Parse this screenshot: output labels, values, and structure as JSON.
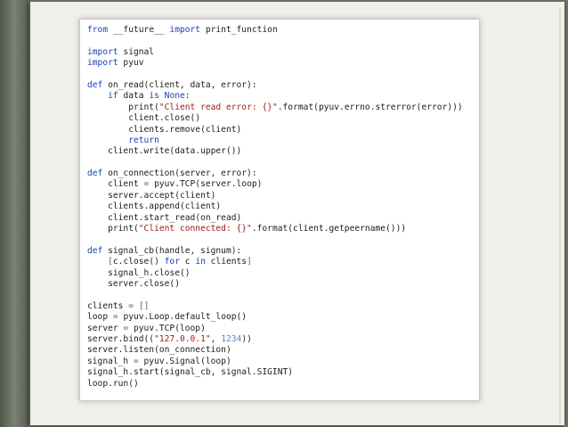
{
  "colors": {
    "background": "#6f7568",
    "page": "#f1efe9",
    "code_background": "#ffffff",
    "keyword": "#1a3fb6",
    "string": "#9a1b1b",
    "number": "#4f87c2",
    "text": "#1c1c1c"
  },
  "code": {
    "language": "python",
    "lines": [
      "from __future__ import print_function",
      "",
      "import signal",
      "import pyuv",
      "",
      "def on_read(client, data, error):",
      "    if data is None:",
      "        print(\"Client read error: {}\".format(pyuv.errno.strerror(error)))",
      "        client.close()",
      "        clients.remove(client)",
      "        return",
      "    client.write(data.upper())",
      "",
      "def on_connection(server, error):",
      "    client = pyuv.TCP(server.loop)",
      "    server.accept(client)",
      "    clients.append(client)",
      "    client.start_read(on_read)",
      "    print(\"Client connected: {}\".format(client.getpeername()))",
      "",
      "def signal_cb(handle, signum):",
      "    [c.close() for c in clients]",
      "    signal_h.close()",
      "    server.close()",
      "",
      "clients = []",
      "loop = pyuv.Loop.default_loop()",
      "server = pyuv.TCP(loop)",
      "server.bind((\"127.0.0.1\", 1234))",
      "server.listen(on_connection)",
      "signal_h = pyuv.Signal(loop)",
      "signal_h.start(signal_cb, signal.SIGINT)",
      "loop.run()"
    ]
  }
}
